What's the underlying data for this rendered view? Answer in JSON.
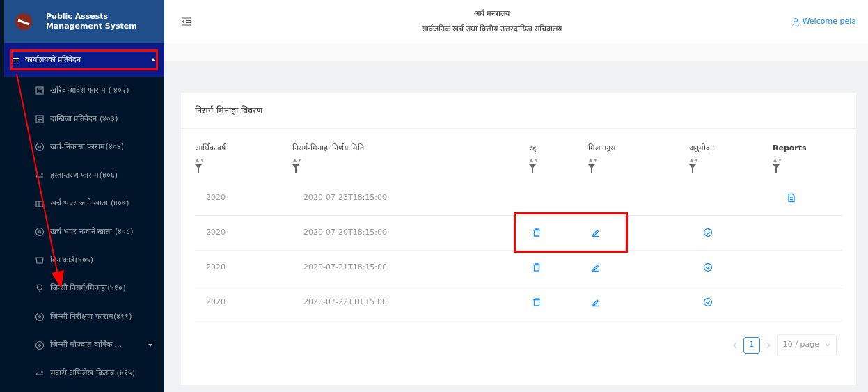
{
  "sidebar": {
    "logo_text": "Public Assests Management System",
    "menu": {
      "label": "कार्यालयको प्रतिवेदन",
      "expanded": true,
      "highlighted": true,
      "items": [
        {
          "label": "खरिद आदेश फाराम ( ४०२)",
          "has_submenu": false
        },
        {
          "label": "दाखिला प्रतिवेदन (४०३)",
          "has_submenu": false
        },
        {
          "label": "खर्च-निकासा फाराम(४०४)",
          "has_submenu": false
        },
        {
          "label": "हस्तान्तरण फाराम(४०६)",
          "has_submenu": false
        },
        {
          "label": "खर्च भएर जाने खाता (४०७)",
          "has_submenu": false
        },
        {
          "label": "खर्च भएर नजाने खाता (४०८)",
          "has_submenu": false
        },
        {
          "label": "बिन कार्ड(४०५)",
          "has_submenu": false
        },
        {
          "label": "जिन्सी निसर्ग/मिनाहा(४१०)",
          "has_submenu": false
        },
        {
          "label": "जिन्सी निरीक्षण फाराम(४११)",
          "has_submenu": false
        },
        {
          "label": "जिन्सी मौज्दात वार्षिक ...",
          "has_submenu": true
        },
        {
          "label": "सवारी अभिलेख किताब (४१५)",
          "has_submenu": false
        }
      ]
    }
  },
  "header": {
    "ministry": "अर्थ मन्त्रालय",
    "office": "सार्वजनिक खर्च तथा वित्तीय उत्तरदायित्व सचिवालय",
    "user": "Welcome pela"
  },
  "card": {
    "title": "निसर्ग-मिनाहा विवरण",
    "columns": [
      "आर्थिक वर्ष",
      "निसर्ग-मिनाहा निर्णय मिति",
      "रद्द",
      "मिलाउनुस",
      "अनुमोदन",
      "Reports"
    ],
    "rows": [
      {
        "year": "2020",
        "date": "2020-07-23T18:15:00",
        "kind": "report",
        "highlighted": false
      },
      {
        "year": "2020",
        "date": "2020-07-20T18:15:00",
        "kind": "actions",
        "highlighted": true
      },
      {
        "year": "2020",
        "date": "2020-07-21T18:15:00",
        "kind": "actions",
        "highlighted": false
      },
      {
        "year": "2020",
        "date": "2020-07-22T18:15:00",
        "kind": "actions",
        "highlighted": false
      }
    ],
    "pagination": {
      "pages": [
        {
          "label": "1",
          "selected": true
        }
      ],
      "page_size": "10 / page"
    }
  }
}
